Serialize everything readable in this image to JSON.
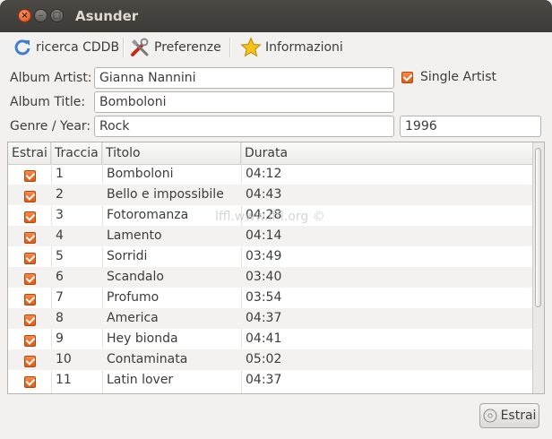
{
  "window": {
    "title": "Asunder",
    "close_glyph": "×",
    "min_glyph": "–",
    "max_glyph": "□"
  },
  "toolbar": {
    "cddb_label": "ricerca CDDB",
    "prefs_label": "Preferenze",
    "about_label": "Informazioni"
  },
  "form": {
    "artist_label": "Album Artist:",
    "artist_value": "Gianna Nannini",
    "single_artist_label": "Single Artist",
    "single_artist_checked": true,
    "title_label": "Album Title:",
    "title_value": "Bomboloni",
    "genre_label": "Genre / Year:",
    "genre_value": "Rock",
    "year_value": "1996"
  },
  "table": {
    "headers": [
      "Estrai",
      "Traccia",
      "Titolo",
      "Durata"
    ],
    "rows": [
      {
        "track": "1",
        "title": "Bomboloni",
        "duration": "04:12"
      },
      {
        "track": "2",
        "title": "Bello e impossibile",
        "duration": "04:43"
      },
      {
        "track": "3",
        "title": "Fotoromanza",
        "duration": "04:28"
      },
      {
        "track": "4",
        "title": "Lamento",
        "duration": "04:14"
      },
      {
        "track": "5",
        "title": "Sorridi",
        "duration": "03:49"
      },
      {
        "track": "6",
        "title": "Scandalo",
        "duration": "03:40"
      },
      {
        "track": "7",
        "title": "Profumo",
        "duration": "03:54"
      },
      {
        "track": "8",
        "title": "America",
        "duration": "04:37"
      },
      {
        "track": "9",
        "title": "Hey bionda",
        "duration": "04:41"
      },
      {
        "track": "10",
        "title": "Contaminata",
        "duration": "05:02"
      },
      {
        "track": "11",
        "title": "Latin lover",
        "duration": "04:37"
      }
    ]
  },
  "watermark": "lffl.www.lffl.org ©",
  "footer": {
    "extract_label": "Estrai"
  },
  "colors": {
    "accent": "#e05c14",
    "titlebar": "#3c3b37"
  }
}
